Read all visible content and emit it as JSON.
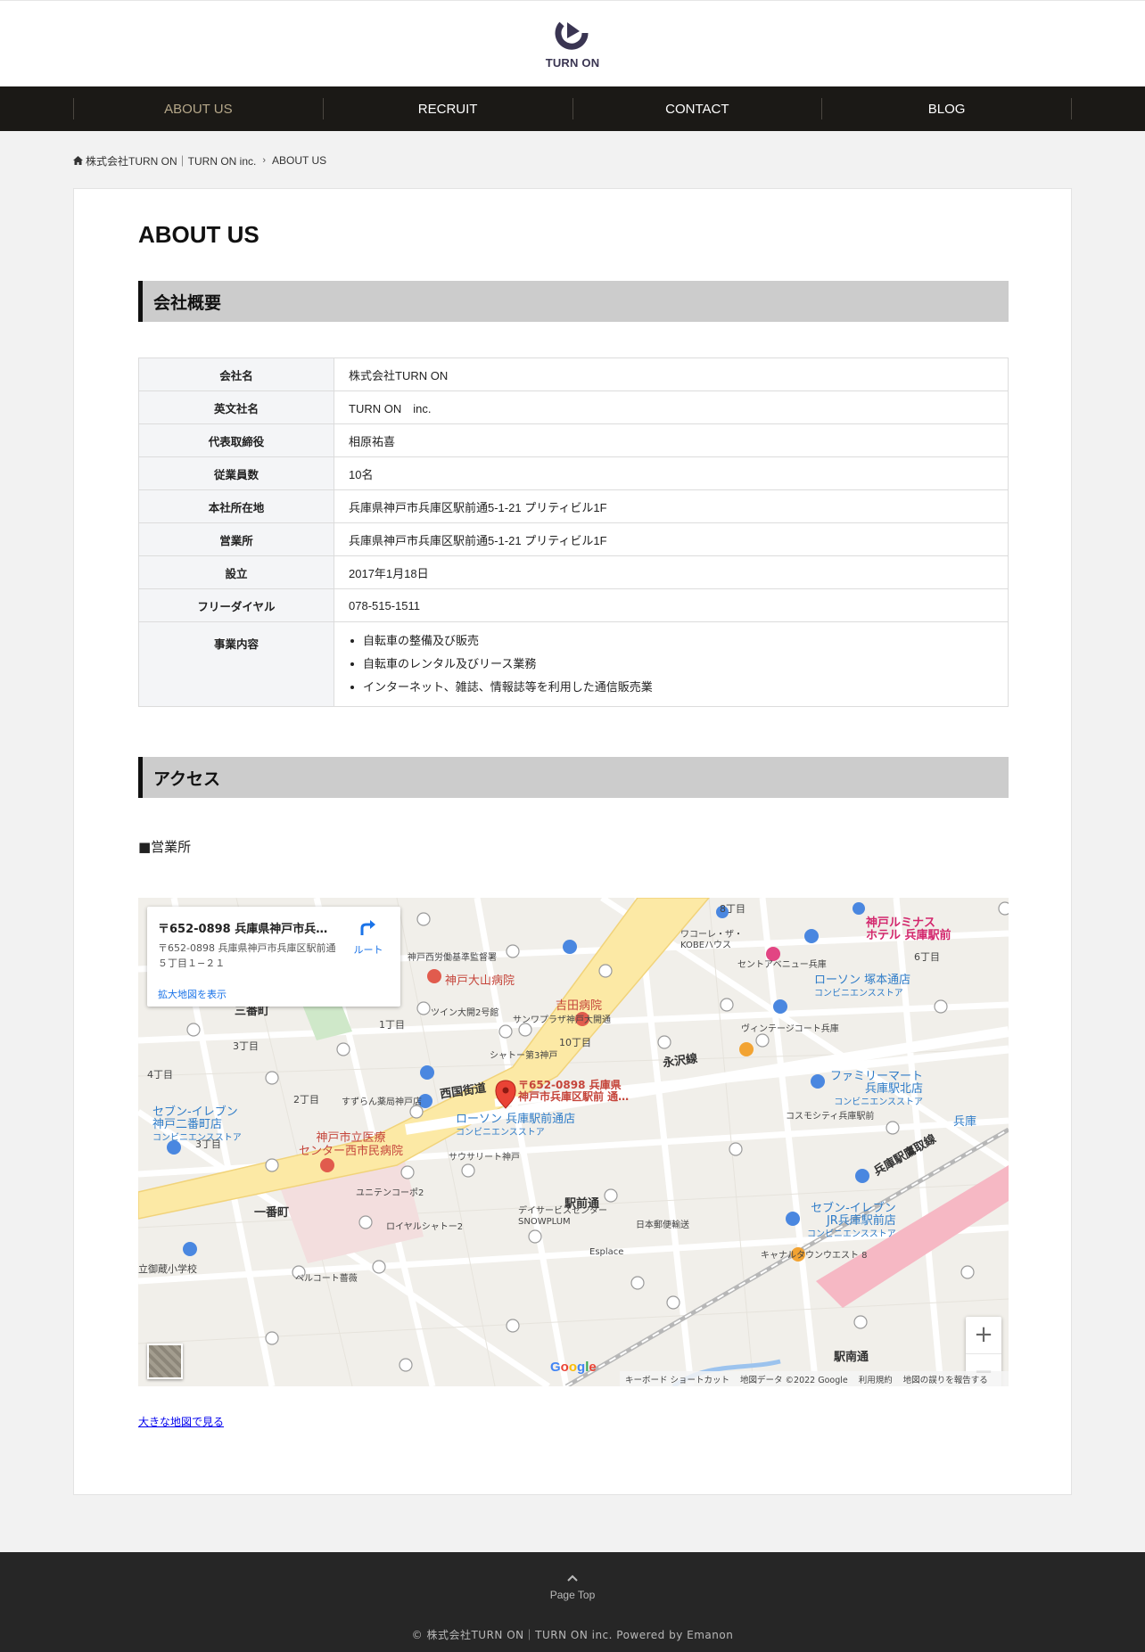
{
  "brand": {
    "logo_text": "TURN ON"
  },
  "nav": {
    "items": [
      {
        "label": "ABOUT US",
        "active": true
      },
      {
        "label": "RECRUIT"
      },
      {
        "label": "CONTACT"
      },
      {
        "label": "BLOG"
      }
    ]
  },
  "breadcrumb": {
    "home": "株式会社TURN ON｜TURN ON inc.",
    "current": "ABOUT US"
  },
  "page": {
    "title": "ABOUT US",
    "section_company": "会社概要",
    "section_access": "アクセス",
    "office_label": "■営業所",
    "big_map_link": "大きな地図で見る"
  },
  "company": {
    "rows": [
      {
        "label": "会社名",
        "value": "株式会社TURN ON"
      },
      {
        "label": "英文社名",
        "value": "TURN ON　inc."
      },
      {
        "label": "代表取締役",
        "value": "相原祐喜"
      },
      {
        "label": "従業員数",
        "value": "10名"
      },
      {
        "label": "本社所在地",
        "value": "兵庫県神戸市兵庫区駅前通5-1-21 プリティビル1F"
      },
      {
        "label": "営業所",
        "value": "兵庫県神戸市兵庫区駅前通5-1-21 プリティビル1F"
      },
      {
        "label": "設立",
        "value": "2017年1月18日"
      },
      {
        "label": "フリーダイヤル",
        "value": "078-515-1511"
      }
    ],
    "business_label": "事業内容",
    "business_items": [
      "自転車の整備及び販売",
      "自転車のレンタル及びリース業務",
      "インターネット、雑誌、情報誌等を利用した通信販売業"
    ]
  },
  "map": {
    "info_title": "〒652-0898 兵庫県神戸市兵庫区駅前通",
    "info_address": "〒652-0898 兵庫県神戸市兵庫区駅前通５丁目１−２１",
    "info_link": "拡大地図を表示",
    "route_label": "ルート",
    "marker_label_line1": "〒652-0898 兵庫県",
    "marker_label_line2": "神戸市兵庫区駅前 通…",
    "zoom_in": "+",
    "zoom_out": "−",
    "google": "Google",
    "footer": [
      "キーボード ショートカット",
      "地図データ ©2022 Google",
      "利用規約",
      "地図の誤りを報告する"
    ],
    "labels": {
      "sanbancho": "三番町",
      "ichibancho": "一番町",
      "nishikunikaido": "西国街道",
      "nagasawasen": "永沢線",
      "ekimaedori": "駅前通",
      "kobeooyama": "神戸大山病院",
      "yoshida": "吉田病院",
      "shiminhospital_1": "神戸市立医療",
      "shiminhospital_2": "センター西市民病院",
      "lawson_1": "ローソン 兵庫駅前通店",
      "lawson_2": "コンビニエンスストア",
      "lawson_tsukamoto": "ローソン 塚本通店",
      "seven_1": "セブン-イレブン",
      "seven_2": "神戸二番町店",
      "seven_jr_1": "セブン-イレブン",
      "seven_jr_2": "JR兵庫駅前店",
      "family_1": "ファミリーマート",
      "family_2": "兵庫駅北店",
      "luminas_1": "神戸ルミナス",
      "luminas_2": "ホテル 兵庫駅前",
      "hyogo_station": "兵庫",
      "hyogo_ekimae_line": "兵庫駅鷹取線",
      "ekinan": "駅南通",
      "chome8": "8丁目",
      "chome6": "6丁目",
      "chome10": "10丁目",
      "chome1": "1丁目",
      "chome2": "2丁目",
      "chome3": "3丁目",
      "chome4": "4丁目",
      "twin_okai": "ツイン大開2号館",
      "sunplaza": "サンワプラザ神戸大開通",
      "chateau": "シャトー第3神戸",
      "wacoal": "ワコーレ・ザ・KOBEハウス",
      "vintage": "ヴィンテージコート兵庫",
      "nishikoku_labor": "神戸西労働基準監督署",
      "centre_avenue": "セントアベニュー兵庫",
      "suzuran": "すずらん薬局神戸店",
      "cosmocity": "コスモシティ兵庫駅前",
      "sausalito": "サウサリート神戸",
      "unitencopo": "ユニテンコーポ2",
      "royal": "ロイヤルシャトー2",
      "snowplum": "デイサービスセンターSNOWPLUM",
      "post": "日本郵便輸送",
      "esplace": "Esplace",
      "canal": "キャナルタウンウエスト 8",
      "belcourt": "ベルコート薔薇",
      "kibou": "立御蔵小学校"
    }
  },
  "footer": {
    "page_top": "Page Top",
    "copyright": "© 株式会社TURN ON｜TURN ON inc. Powered by Emanon"
  },
  "colors": {
    "nav_bg": "#1b1916",
    "nav_active": "#b5a789",
    "section_bg": "#cccccc",
    "footer_bg": "#262626",
    "map_marker": "#ea4335"
  }
}
